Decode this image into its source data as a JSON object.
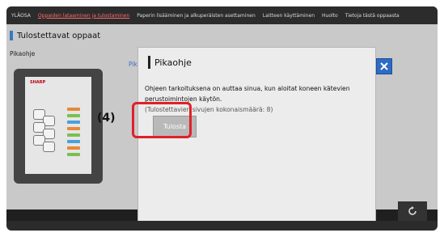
{
  "nav": {
    "tabs": [
      {
        "label": "YLÄOSA"
      },
      {
        "label": "Oppaiden lataaminen ja tulostaminen"
      },
      {
        "label": "Paperin lisääminen ja alkuperäisten asettaminen"
      },
      {
        "label": "Laitteen käyttäminen"
      },
      {
        "label": "Huolto"
      },
      {
        "label": "Tietoja tästä oppaasta"
      }
    ]
  },
  "page": {
    "title": "Tulostettavat oppaat",
    "side_label": "Pikaohje",
    "side_link": "Pik"
  },
  "guide_card": {
    "brand": "SHARP"
  },
  "dialog": {
    "title": "Pikaohje",
    "description": "Ohjeen tarkoituksena on auttaa sinua, kun aloitat koneen kätevien perustoimintojen käytön.",
    "pages": "(Tulostettavien sivujen kokonaismäärä: 8)",
    "print_button": "Tulosta",
    "close_icon": "close-icon"
  },
  "annotation": {
    "step": "(4)"
  },
  "colors": {
    "accent_blue": "#2d6bc4",
    "highlight_red": "#e0202a",
    "active_tab": "#ff6a6a"
  }
}
